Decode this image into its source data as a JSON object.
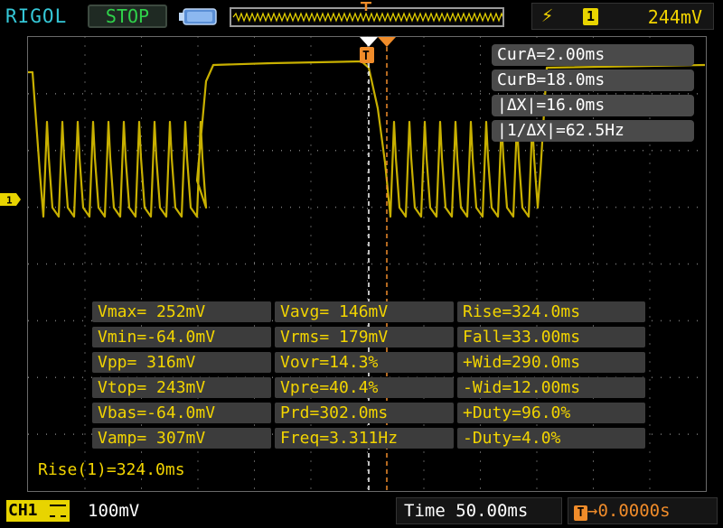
{
  "header": {
    "brand": "RIGOL",
    "run_state": "STOP",
    "trigger_source": "1",
    "trigger_level": "244mV"
  },
  "colors": {
    "channel1": "#e8d400",
    "trace": "#c8b000",
    "cursor_a": "#ffffff",
    "cursor_b": "#f08c2a",
    "brand": "#35c8d8",
    "run_state": "#2fd24a"
  },
  "cursors": {
    "cur_a": "CurA=2.00ms",
    "cur_b": "CurB=18.0ms",
    "delta_x": "|ΔX|=16.0ms",
    "inv_delta_x": "|1/ΔX|=62.5Hz"
  },
  "measurements": {
    "col1": [
      "Vmax= 252mV",
      "Vmin=-64.0mV",
      "Vpp= 316mV",
      "Vtop= 243mV",
      "Vbas=-64.0mV",
      "Vamp= 307mV"
    ],
    "col2": [
      "Vavg= 146mV",
      "Vrms= 179mV",
      "Vovr=14.3%",
      "Vpre=40.4%",
      "Prd=302.0ms",
      "Freq=3.311Hz"
    ],
    "col3": [
      "Rise=324.0ms",
      "Fall=33.00ms",
      "+Wid=290.0ms",
      "-Wid=12.00ms",
      "+Duty=96.0%",
      "-Duty=4.0%"
    ]
  },
  "statistic": "Rise(1)=324.0ms",
  "footer": {
    "channel_label": "CH1",
    "channel_scale": "100mV",
    "timebase": "Time 50.00ms",
    "trigger_offset": "0.0000s"
  },
  "icons": {
    "trigger_edge": "rising-edge-icon",
    "battery": "battery-icon",
    "trigger_position": "trigger-position-icon",
    "channel_marker": "channel-1-marker-icon"
  }
}
